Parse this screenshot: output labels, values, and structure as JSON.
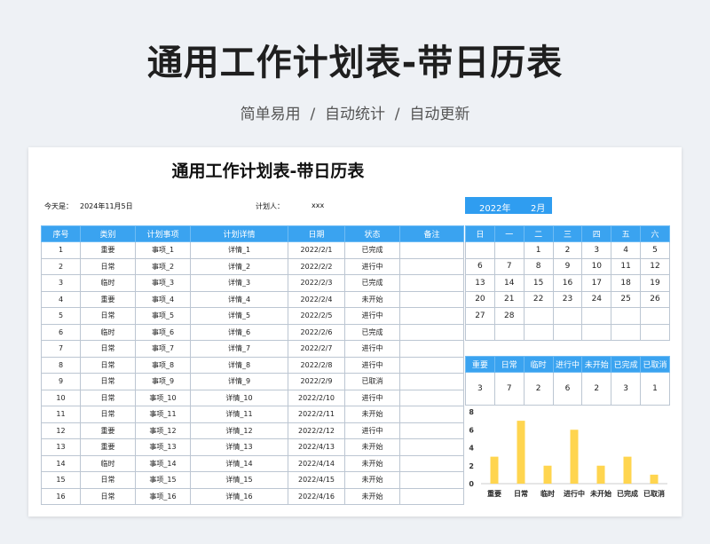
{
  "header": {
    "title": "通用工作计划表-带日历表",
    "subtitle": "简单易用  /  自动统计  /  自动更新"
  },
  "sheet": {
    "title": "通用工作计划表-带日历表",
    "today_label": "今天是：",
    "today_value": "2024年11月5日",
    "planner_label": "计划人：",
    "planner_value": "xxx",
    "year": "2022年",
    "month": "2月"
  },
  "table": {
    "headers": [
      "序号",
      "类别",
      "计划事项",
      "计划详情",
      "日期",
      "状态",
      "备注"
    ],
    "rows": [
      [
        "1",
        "重要",
        "事项_1",
        "详情_1",
        "2022/2/1",
        "已完成",
        ""
      ],
      [
        "2",
        "日常",
        "事项_2",
        "详情_2",
        "2022/2/2",
        "进行中",
        ""
      ],
      [
        "3",
        "临时",
        "事项_3",
        "详情_3",
        "2022/2/3",
        "已完成",
        ""
      ],
      [
        "4",
        "重要",
        "事项_4",
        "详情_4",
        "2022/2/4",
        "未开始",
        ""
      ],
      [
        "5",
        "日常",
        "事项_5",
        "详情_5",
        "2022/2/5",
        "进行中",
        ""
      ],
      [
        "6",
        "临时",
        "事项_6",
        "详情_6",
        "2022/2/6",
        "已完成",
        ""
      ],
      [
        "7",
        "日常",
        "事项_7",
        "详情_7",
        "2022/2/7",
        "进行中",
        ""
      ],
      [
        "8",
        "日常",
        "事项_8",
        "详情_8",
        "2022/2/8",
        "进行中",
        ""
      ],
      [
        "9",
        "日常",
        "事项_9",
        "详情_9",
        "2022/2/9",
        "已取消",
        ""
      ],
      [
        "10",
        "日常",
        "事项_10",
        "详情_10",
        "2022/2/10",
        "进行中",
        ""
      ],
      [
        "11",
        "日常",
        "事项_11",
        "详情_11",
        "2022/2/11",
        "未开始",
        ""
      ],
      [
        "12",
        "重要",
        "事项_12",
        "详情_12",
        "2022/2/12",
        "进行中",
        ""
      ],
      [
        "13",
        "重要",
        "事项_13",
        "详情_13",
        "2022/4/13",
        "未开始",
        ""
      ],
      [
        "14",
        "临时",
        "事项_14",
        "详情_14",
        "2022/4/14",
        "未开始",
        ""
      ],
      [
        "15",
        "日常",
        "事项_15",
        "详情_15",
        "2022/4/15",
        "未开始",
        ""
      ],
      [
        "16",
        "日常",
        "事项_16",
        "详情_16",
        "2022/4/16",
        "未开始",
        ""
      ]
    ]
  },
  "calendar": {
    "weekdays": [
      "日",
      "一",
      "二",
      "三",
      "四",
      "五",
      "六"
    ],
    "weeks": [
      [
        "",
        "",
        "1",
        "2",
        "3",
        "4",
        "5"
      ],
      [
        "6",
        "7",
        "8",
        "9",
        "10",
        "11",
        "12"
      ],
      [
        "13",
        "14",
        "15",
        "16",
        "17",
        "18",
        "19"
      ],
      [
        "20",
        "21",
        "22",
        "23",
        "24",
        "25",
        "26"
      ],
      [
        "27",
        "28",
        "",
        "",
        "",
        "",
        ""
      ],
      [
        "",
        "",
        "",
        "",
        "",
        "",
        ""
      ]
    ]
  },
  "stats": {
    "labels": [
      "重要",
      "日常",
      "临时",
      "进行中",
      "未开始",
      "已完成",
      "已取消"
    ],
    "values": [
      "3",
      "7",
      "2",
      "6",
      "2",
      "3",
      "1"
    ]
  },
  "chart_data": {
    "type": "bar",
    "categories": [
      "重要",
      "日常",
      "临时",
      "进行中",
      "未开始",
      "已完成",
      "已取消"
    ],
    "values": [
      3,
      7,
      2,
      6,
      2,
      3,
      1
    ],
    "ylim": [
      0,
      8
    ],
    "yticks": [
      0,
      2,
      4,
      6,
      8
    ],
    "bar_color": "#ffd54f",
    "grid": false
  },
  "colors": {
    "header_blue": "#3aa3f0",
    "bar_yellow": "#ffd54f"
  }
}
